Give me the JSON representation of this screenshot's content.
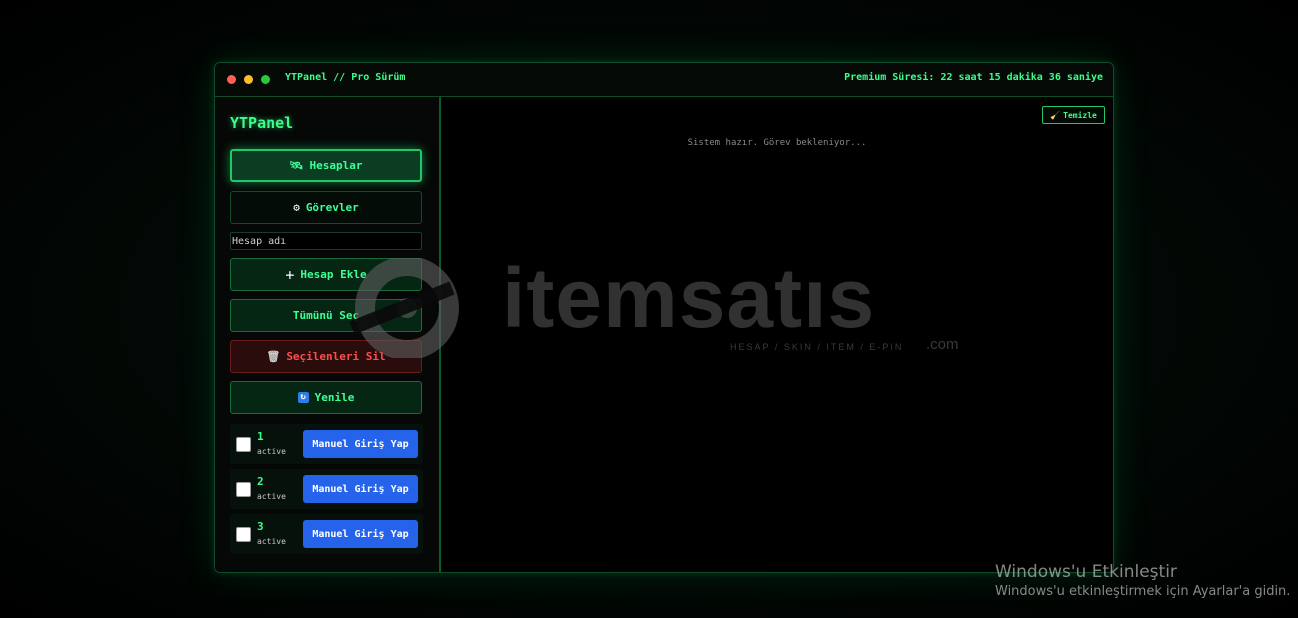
{
  "window": {
    "title": "YTPanel // Pro Sürüm",
    "premium": "Premium Süresi: 22 saat 15 dakika 36 saniye"
  },
  "sidebar": {
    "brand": "YTPanel",
    "nav": {
      "accounts_label": "Hesaplar",
      "tasks_label": "Görevler"
    },
    "account_input": {
      "placeholder": "Hesap adı"
    },
    "actions": {
      "add_label": "Hesap Ekle",
      "select_all_label": "Tümünü Seç",
      "delete_selected_label": "Seçilenleri Sil",
      "refresh_label": "Yenile"
    },
    "accounts": [
      {
        "number": "1",
        "status": "active",
        "login_label": "Manuel Giriş Yap"
      },
      {
        "number": "2",
        "status": "active",
        "login_label": "Manuel Giriş Yap"
      },
      {
        "number": "3",
        "status": "active",
        "login_label": "Manuel Giriş Yap"
      }
    ]
  },
  "main": {
    "clear_label": "Temizle",
    "status_message": "Sistem hazır. Görev bekleniyor..."
  },
  "watermark": {
    "name": "itemsatıs",
    "tagline": "HESAP / SKIN / ITEM / E-PIN",
    "suffix": ".com"
  },
  "os_notice": {
    "title": "Windows'u Etkinleştir",
    "subtitle": "Windows'u etkinleştirmek için Ayarlar'a gidin."
  },
  "colors": {
    "accent": "#39ff88",
    "login_button": "#2563eb",
    "danger": "#ff4d4d"
  },
  "icons": [
    "satellite-icon",
    "gear-icon",
    "plus-icon",
    "trash-icon",
    "refresh-icon",
    "broom-icon"
  ]
}
